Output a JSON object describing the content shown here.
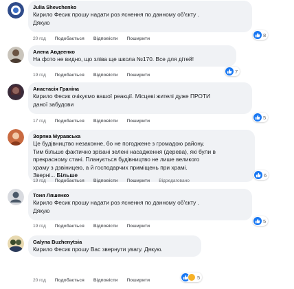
{
  "action_labels": {
    "like": "Подобається",
    "reply": "Відповісти",
    "share": "Поширити"
  },
  "comments": [
    {
      "author": "Julia Shevchenko",
      "lines": [
        "Кирило Фесик прошу надати роз яснення по данному об'єкту .",
        "Дякую"
      ],
      "time": "20 год",
      "reactions": "8"
    },
    {
      "author": "Алена Авдеенко",
      "lines": [
        "На фото не видно, що зліва ще школа №170. Все для дітей!"
      ],
      "time": "19 год",
      "reactions": "7"
    },
    {
      "author": "Анастасія Граніна",
      "lines": [
        "Кирило Фесик очікуємо вашої реакції. Місцеві жителі дуже ПРОТИ",
        "даної забудови"
      ],
      "time": "17 год",
      "reactions": "5"
    },
    {
      "author": "Зоряна Муравська",
      "lines": [
        "Це будівництво незаконне, бо не погоджене з громадою району.",
        "Тим більше фактично зрізані зелені насадження (дерева), які були в",
        "прекрасному стані. Планується будівництво не лише великого",
        "храму з дзвіницею, а й господарчих приміщень при храмі.",
        "Зверні..."
      ],
      "more": "Більше",
      "time": "19 год",
      "edited": "Відредаговано",
      "reactions": "6"
    },
    {
      "author": "Тоня Ляшенко",
      "lines": [
        "Кирило Фесик прошу надати роз яснення по данному об'єкту .",
        "Дякую"
      ],
      "time": "19 год",
      "reactions": "5"
    },
    {
      "author": "Galyna Buzhenytsia",
      "lines": [
        "Кирило Фесик прошу Вас звернути увагу. Дякую."
      ],
      "time": "20 год",
      "reactions": "5"
    }
  ]
}
